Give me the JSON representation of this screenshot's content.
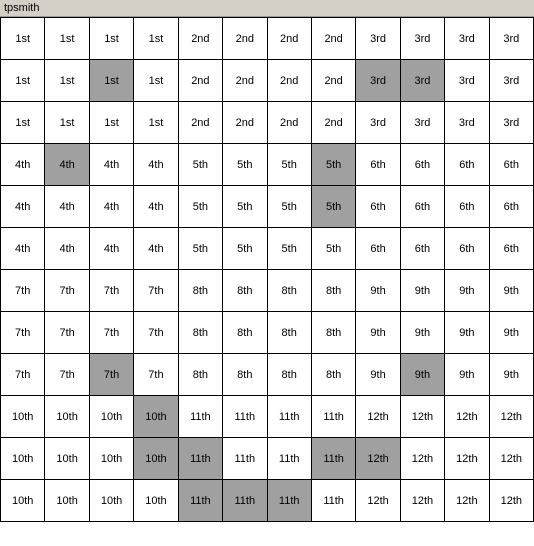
{
  "title": "tpsmith",
  "rows": [
    [
      {
        "text": "1st",
        "hl": false
      },
      {
        "text": "1st",
        "hl": false
      },
      {
        "text": "1st",
        "hl": false
      },
      {
        "text": "1st",
        "hl": false
      },
      {
        "text": "2nd",
        "hl": false
      },
      {
        "text": "2nd",
        "hl": false
      },
      {
        "text": "2nd",
        "hl": false
      },
      {
        "text": "2nd",
        "hl": false
      },
      {
        "text": "3rd",
        "hl": false
      },
      {
        "text": "3rd",
        "hl": false
      },
      {
        "text": "3rd",
        "hl": false
      },
      {
        "text": "3rd",
        "hl": false
      }
    ],
    [
      {
        "text": "1st",
        "hl": false
      },
      {
        "text": "1st",
        "hl": false
      },
      {
        "text": "1st",
        "hl": true
      },
      {
        "text": "1st",
        "hl": false
      },
      {
        "text": "2nd",
        "hl": false
      },
      {
        "text": "2nd",
        "hl": false
      },
      {
        "text": "2nd",
        "hl": false
      },
      {
        "text": "2nd",
        "hl": false
      },
      {
        "text": "3rd",
        "hl": true
      },
      {
        "text": "3rd",
        "hl": true
      },
      {
        "text": "3rd",
        "hl": false
      },
      {
        "text": "3rd",
        "hl": false
      }
    ],
    [
      {
        "text": "1st",
        "hl": false
      },
      {
        "text": "1st",
        "hl": false
      },
      {
        "text": "1st",
        "hl": false
      },
      {
        "text": "1st",
        "hl": false
      },
      {
        "text": "2nd",
        "hl": false
      },
      {
        "text": "2nd",
        "hl": false
      },
      {
        "text": "2nd",
        "hl": false
      },
      {
        "text": "2nd",
        "hl": false
      },
      {
        "text": "3rd",
        "hl": false
      },
      {
        "text": "3rd",
        "hl": false
      },
      {
        "text": "3rd",
        "hl": false
      },
      {
        "text": "3rd",
        "hl": false
      }
    ],
    [
      {
        "text": "4th",
        "hl": false
      },
      {
        "text": "4th",
        "hl": true
      },
      {
        "text": "4th",
        "hl": false
      },
      {
        "text": "4th",
        "hl": false
      },
      {
        "text": "5th",
        "hl": false
      },
      {
        "text": "5th",
        "hl": false
      },
      {
        "text": "5th",
        "hl": false
      },
      {
        "text": "5th",
        "hl": true
      },
      {
        "text": "6th",
        "hl": false
      },
      {
        "text": "6th",
        "hl": false
      },
      {
        "text": "6th",
        "hl": false
      },
      {
        "text": "6th",
        "hl": false
      }
    ],
    [
      {
        "text": "4th",
        "hl": false
      },
      {
        "text": "4th",
        "hl": false
      },
      {
        "text": "4th",
        "hl": false
      },
      {
        "text": "4th",
        "hl": false
      },
      {
        "text": "5th",
        "hl": false
      },
      {
        "text": "5th",
        "hl": false
      },
      {
        "text": "5th",
        "hl": false
      },
      {
        "text": "5th",
        "hl": true
      },
      {
        "text": "6th",
        "hl": false
      },
      {
        "text": "6th",
        "hl": false
      },
      {
        "text": "6th",
        "hl": false
      },
      {
        "text": "6th",
        "hl": false
      }
    ],
    [
      {
        "text": "4th",
        "hl": false
      },
      {
        "text": "4th",
        "hl": false
      },
      {
        "text": "4th",
        "hl": false
      },
      {
        "text": "4th",
        "hl": false
      },
      {
        "text": "5th",
        "hl": false
      },
      {
        "text": "5th",
        "hl": false
      },
      {
        "text": "5th",
        "hl": false
      },
      {
        "text": "5th",
        "hl": false
      },
      {
        "text": "6th",
        "hl": false
      },
      {
        "text": "6th",
        "hl": false
      },
      {
        "text": "6th",
        "hl": false
      },
      {
        "text": "6th",
        "hl": false
      }
    ],
    [
      {
        "text": "7th",
        "hl": false
      },
      {
        "text": "7th",
        "hl": false
      },
      {
        "text": "7th",
        "hl": false
      },
      {
        "text": "7th",
        "hl": false
      },
      {
        "text": "8th",
        "hl": false
      },
      {
        "text": "8th",
        "hl": false
      },
      {
        "text": "8th",
        "hl": false
      },
      {
        "text": "8th",
        "hl": false
      },
      {
        "text": "9th",
        "hl": false
      },
      {
        "text": "9th",
        "hl": false
      },
      {
        "text": "9th",
        "hl": false
      },
      {
        "text": "9th",
        "hl": false
      }
    ],
    [
      {
        "text": "7th",
        "hl": false
      },
      {
        "text": "7th",
        "hl": false
      },
      {
        "text": "7th",
        "hl": false
      },
      {
        "text": "7th",
        "hl": false
      },
      {
        "text": "8th",
        "hl": false
      },
      {
        "text": "8th",
        "hl": false
      },
      {
        "text": "8th",
        "hl": false
      },
      {
        "text": "8th",
        "hl": false
      },
      {
        "text": "9th",
        "hl": false
      },
      {
        "text": "9th",
        "hl": false
      },
      {
        "text": "9th",
        "hl": false
      },
      {
        "text": "9th",
        "hl": false
      }
    ],
    [
      {
        "text": "7th",
        "hl": false
      },
      {
        "text": "7th",
        "hl": false
      },
      {
        "text": "7th",
        "hl": true
      },
      {
        "text": "7th",
        "hl": false
      },
      {
        "text": "8th",
        "hl": false
      },
      {
        "text": "8th",
        "hl": false
      },
      {
        "text": "8th",
        "hl": false
      },
      {
        "text": "8th",
        "hl": false
      },
      {
        "text": "9th",
        "hl": false
      },
      {
        "text": "9th",
        "hl": true
      },
      {
        "text": "9th",
        "hl": false
      },
      {
        "text": "9th",
        "hl": false
      }
    ],
    [
      {
        "text": "10th",
        "hl": false
      },
      {
        "text": "10th",
        "hl": false
      },
      {
        "text": "10th",
        "hl": false
      },
      {
        "text": "10th",
        "hl": true
      },
      {
        "text": "11th",
        "hl": false
      },
      {
        "text": "11th",
        "hl": false
      },
      {
        "text": "11th",
        "hl": false
      },
      {
        "text": "11th",
        "hl": false
      },
      {
        "text": "12th",
        "hl": false
      },
      {
        "text": "12th",
        "hl": false
      },
      {
        "text": "12th",
        "hl": false
      },
      {
        "text": "12th",
        "hl": false
      }
    ],
    [
      {
        "text": "10th",
        "hl": false
      },
      {
        "text": "10th",
        "hl": false
      },
      {
        "text": "10th",
        "hl": false
      },
      {
        "text": "10th",
        "hl": true
      },
      {
        "text": "11th",
        "hl": true
      },
      {
        "text": "11th",
        "hl": false
      },
      {
        "text": "11th",
        "hl": false
      },
      {
        "text": "11th",
        "hl": true
      },
      {
        "text": "12th",
        "hl": true
      },
      {
        "text": "12th",
        "hl": false
      },
      {
        "text": "12th",
        "hl": false
      },
      {
        "text": "12th",
        "hl": false
      }
    ],
    [
      {
        "text": "10th",
        "hl": false
      },
      {
        "text": "10th",
        "hl": false
      },
      {
        "text": "10th",
        "hl": false
      },
      {
        "text": "10th",
        "hl": false
      },
      {
        "text": "11th",
        "hl": true
      },
      {
        "text": "11th",
        "hl": true
      },
      {
        "text": "11th",
        "hl": true
      },
      {
        "text": "11th",
        "hl": false
      },
      {
        "text": "12th",
        "hl": false
      },
      {
        "text": "12th",
        "hl": false
      },
      {
        "text": "12th",
        "hl": false
      },
      {
        "text": "12th",
        "hl": false
      }
    ]
  ]
}
